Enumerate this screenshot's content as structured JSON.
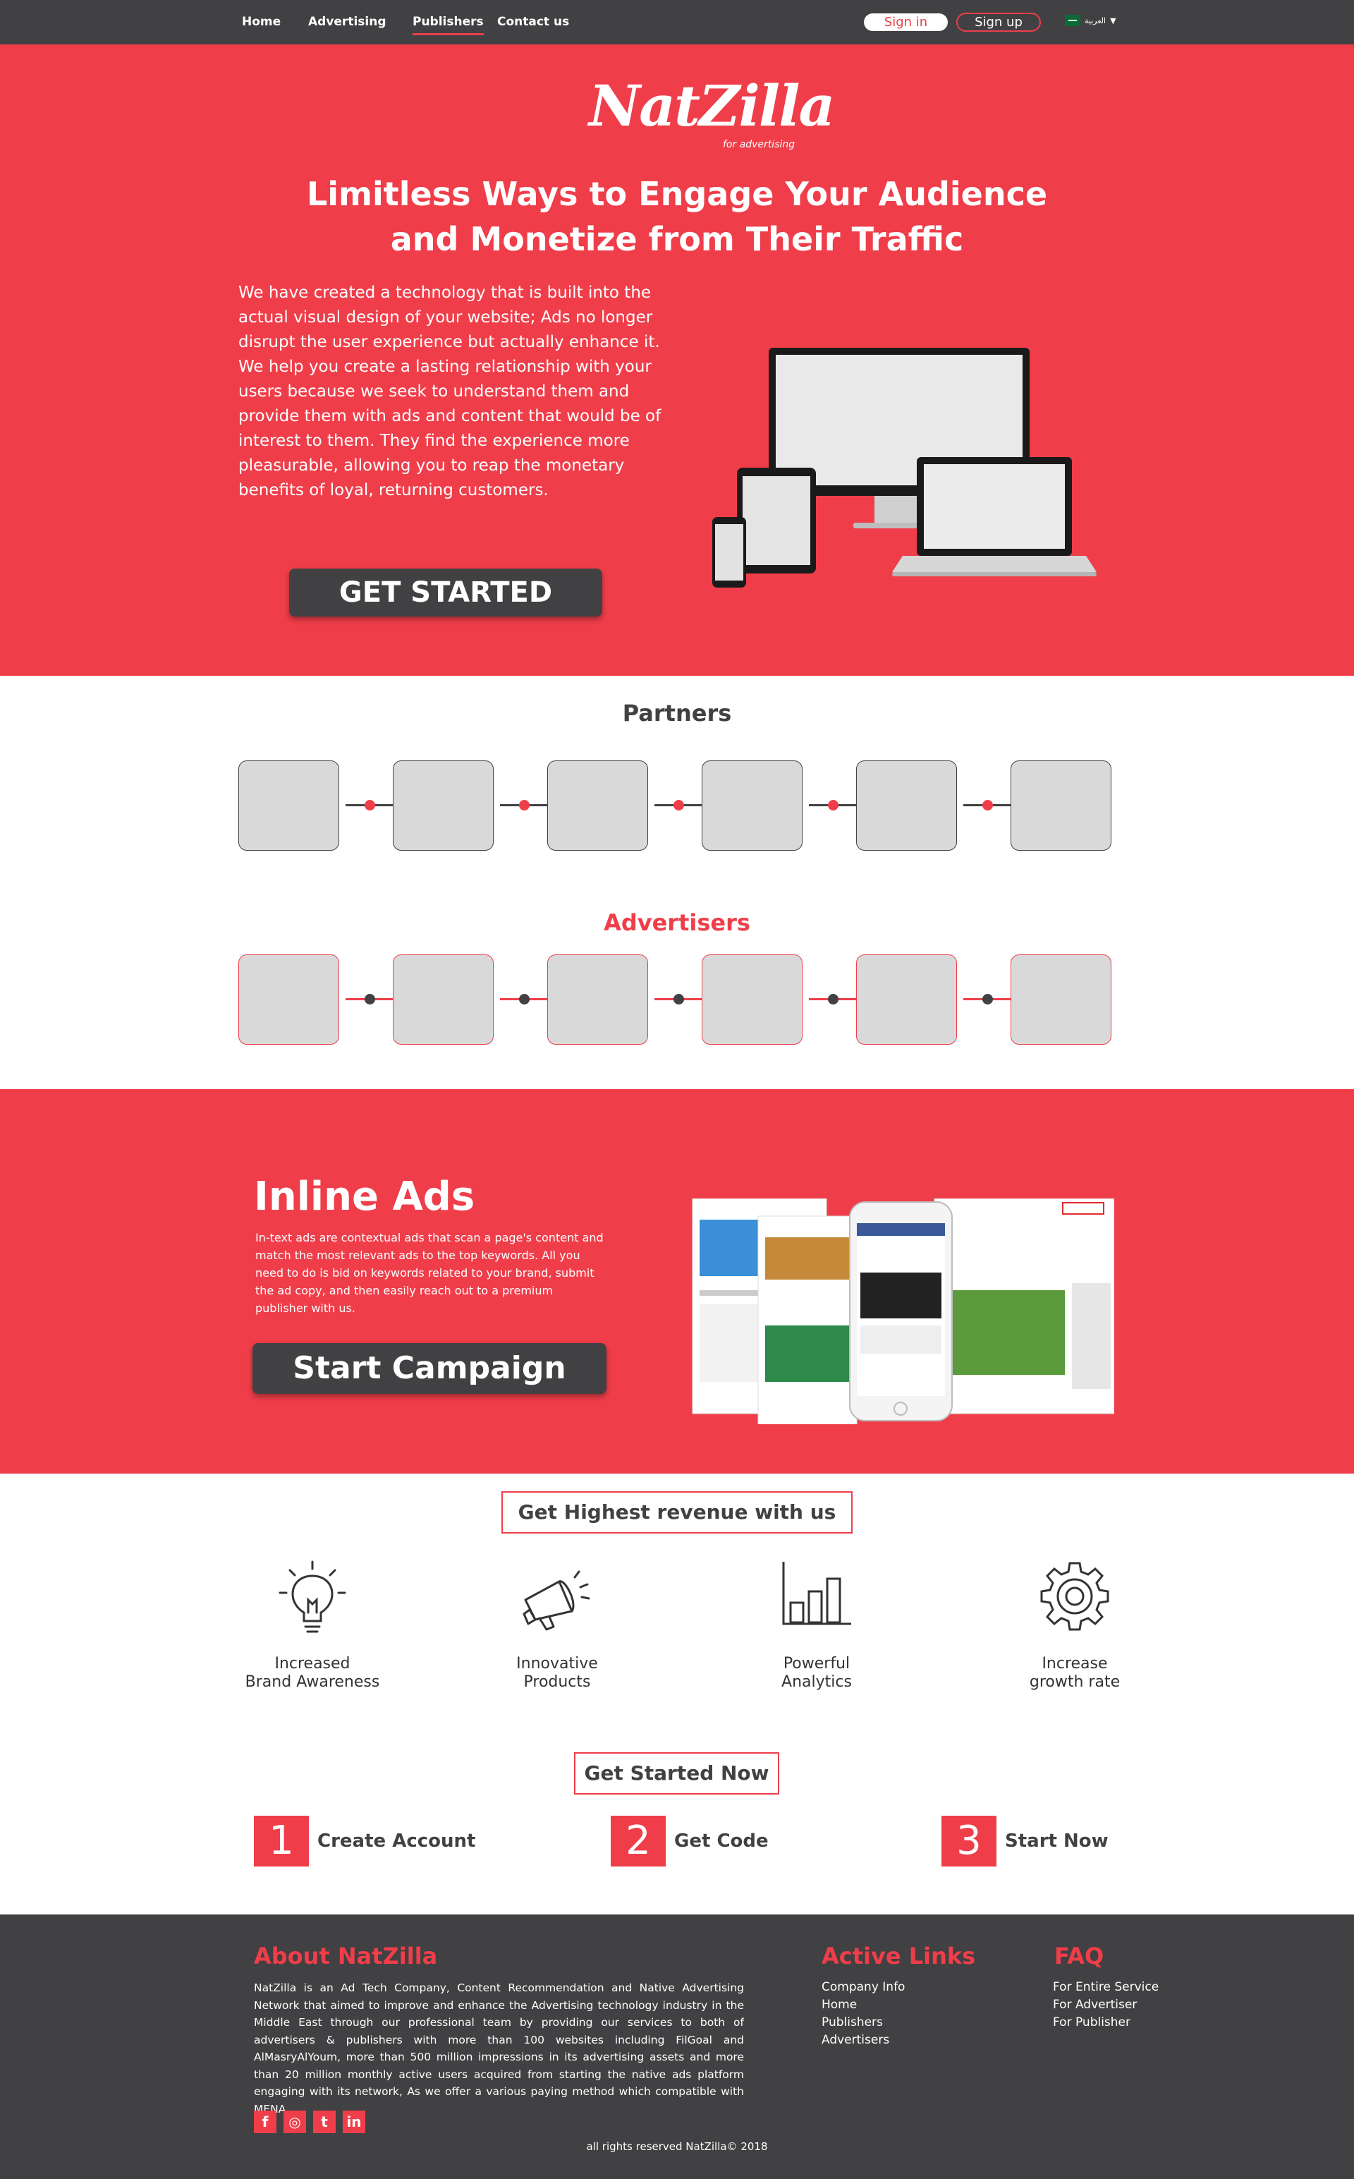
{
  "nav": {
    "links": [
      "Home",
      "Advertising",
      "Publishers",
      "Contact us"
    ],
    "active": "Publishers",
    "sign_in": "Sign in",
    "sign_up": "Sign up",
    "language": "العربية"
  },
  "hero": {
    "logo_text": "NatZilla",
    "logo_sub": "for advertising",
    "title_line1": "Limitless Ways to Engage Your Audience",
    "title_line2": "and Monetize from Their Traffic",
    "body": "We have created a technology that is built into the actual visual design of your website; Ads no longer disrupt the user experience but actually enhance it. We help you create a lasting relationship with your users because we seek to understand them and provide them with ads and content that would be of interest to them. They find the experience more pleasurable, allowing you to reap the monetary benefits of loyal, returning customers.",
    "cta": "GET STARTED"
  },
  "partners": {
    "title": "Partners"
  },
  "advertisers": {
    "title": "Advertisers"
  },
  "inline_ads": {
    "title": "Inline Ads",
    "body": "In-text ads are contextual ads that scan a page's content and match the most relevant ads to the top keywords. All you need to do is bid on keywords related to your brand, submit the ad copy, and then easily reach out to a premium publisher with us.",
    "cta": "Start Campaign"
  },
  "revenue": {
    "heading": "Get Highest revenue with us",
    "features": [
      {
        "line1": "Increased",
        "line2": "Brand Awareness",
        "icon": "lightbulb-icon"
      },
      {
        "line1": "Innovative",
        "line2": "Products",
        "icon": "megaphone-icon"
      },
      {
        "line1": "Powerful",
        "line2": "Analytics",
        "icon": "bar-chart-icon"
      },
      {
        "line1": "Increase",
        "line2": "growth rate",
        "icon": "gear-icon"
      }
    ]
  },
  "steps": {
    "heading": "Get Started Now",
    "items": [
      {
        "num": "1",
        "label": "Create Account"
      },
      {
        "num": "2",
        "label": "Get Code"
      },
      {
        "num": "3",
        "label": "Start Now"
      }
    ]
  },
  "footer": {
    "about_title": "About NatZilla",
    "about_body": "NatZilla is an Ad Tech Company, Content Recommendation and Native Advertising Network that aimed to improve and enhance the Advertising technology industry in the Middle East through our professional team by providing our services to both of advertisers & publishers with more than 100 websites including FilGoal and AlMasryAlYoum, more than 500 million impressions in its advertising assets and more than 20 million monthly active users acquired from starting the native ads platform engaging with its network, As we offer a various paying method which compatible with MENA.",
    "links_title": "Active Links",
    "links": [
      "Company Info",
      "Home",
      "Publishers",
      "Advertisers"
    ],
    "faq_title": "FAQ",
    "faq": [
      "For Entire Service",
      "For Advertiser",
      "For Publisher"
    ],
    "copyright": "all rights reserved NatZilla© 2018"
  },
  "colors": {
    "brand_red": "#ef3e4a",
    "dark": "#414042"
  }
}
